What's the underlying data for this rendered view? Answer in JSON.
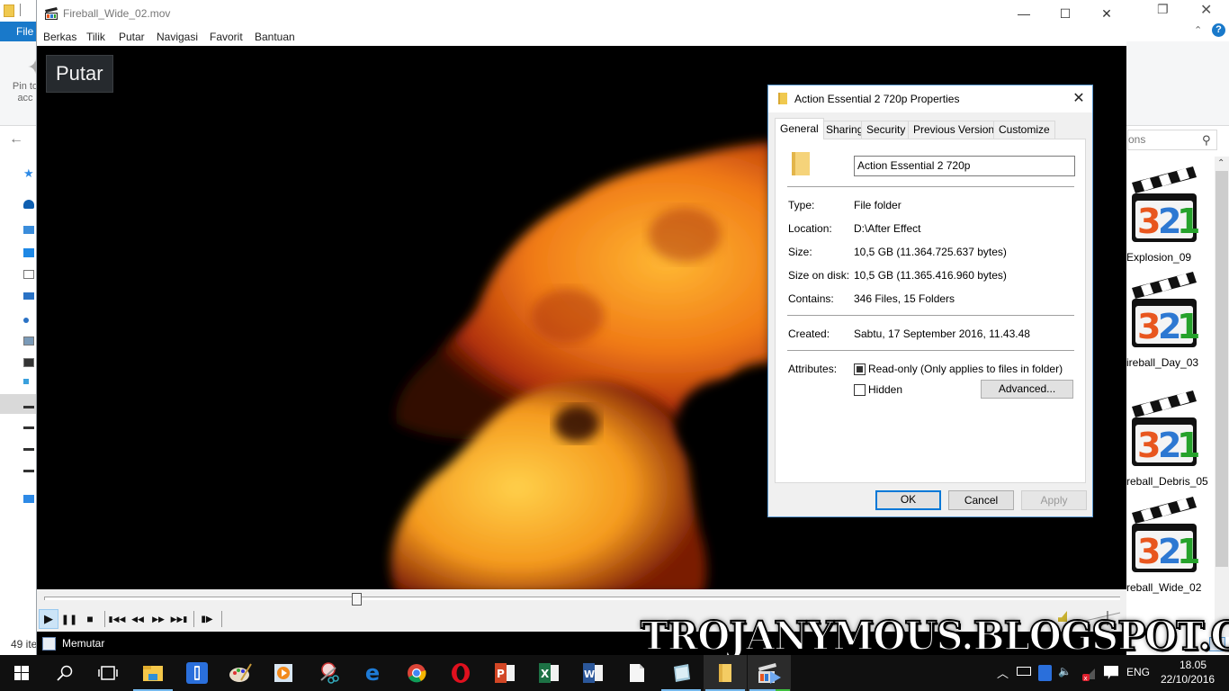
{
  "explorer": {
    "ribbon_file_tab": "File",
    "pin_label_partial": "Pin to acc",
    "search_placeholder_partial": "ons",
    "status_items_partial": "49 ite",
    "files": [
      {
        "label": "Explosion_09"
      },
      {
        "label": "ireball_Day_03"
      },
      {
        "label": "reball_Debris_05"
      },
      {
        "label": "reball_Wide_02"
      }
    ]
  },
  "player": {
    "title": "Fireball_Wide_02.mov",
    "menu": [
      "Berkas",
      "Tilik",
      "Putar",
      "Navigasi",
      "Favorit",
      "Bantuan"
    ],
    "osd_text": "Putar",
    "status_text": "Memutar",
    "seek_position_fraction": 0.29,
    "controls": {
      "play": "play-icon",
      "pause": "pause-icon",
      "stop": "stop-icon",
      "prev": "skip-back-icon",
      "rewind": "rewind-icon",
      "forward": "fast-forward-icon",
      "next": "skip-forward-icon",
      "frame_step": "frame-step-icon"
    }
  },
  "properties": {
    "title": "Action Essential 2 720p Properties",
    "tabs": [
      "General",
      "Sharing",
      "Security",
      "Previous Versions",
      "Customize"
    ],
    "selected_tab": "General",
    "folder_name": "Action Essential 2 720p",
    "fields": [
      {
        "label": "Type:",
        "value": "File folder"
      },
      {
        "label": "Location:",
        "value": "D:\\After Effect"
      },
      {
        "label": "Size:",
        "value": "10,5 GB (11.364.725.637 bytes)"
      },
      {
        "label": "Size on disk:",
        "value": "10,5 GB (11.365.416.960 bytes)"
      },
      {
        "label": "Contains:",
        "value": "346 Files, 15 Folders"
      }
    ],
    "created_label": "Created:",
    "created_value": "Sabtu, 17 September 2016, 11.43.48",
    "attributes_label": "Attributes:",
    "readonly_label": "Read-only (Only applies to files in folder)",
    "readonly_state": "indeterminate",
    "hidden_label": "Hidden",
    "hidden_checked": false,
    "advanced_button": "Advanced...",
    "ok_button": "OK",
    "cancel_button": "Cancel",
    "apply_button": "Apply"
  },
  "watermark": "TROJANYMOUS.BLOGSPOT.COM",
  "taskbar": {
    "apps": [
      "start",
      "search",
      "task-view",
      "file-explorer",
      "battery-app",
      "paint",
      "media-player",
      "snipping-tool",
      "edge",
      "chrome",
      "opera",
      "powerpoint",
      "excel",
      "word",
      "notepad-blank",
      "notes",
      "folder",
      "mpc-hc"
    ],
    "tray_language": "ENG",
    "time": "18.05",
    "date": "22/10/2016"
  },
  "colors": {
    "accent": "#0078d7",
    "file_tab": "#1979ca",
    "taskbar": "#101010",
    "dialog_border": "#5e9cd3"
  }
}
